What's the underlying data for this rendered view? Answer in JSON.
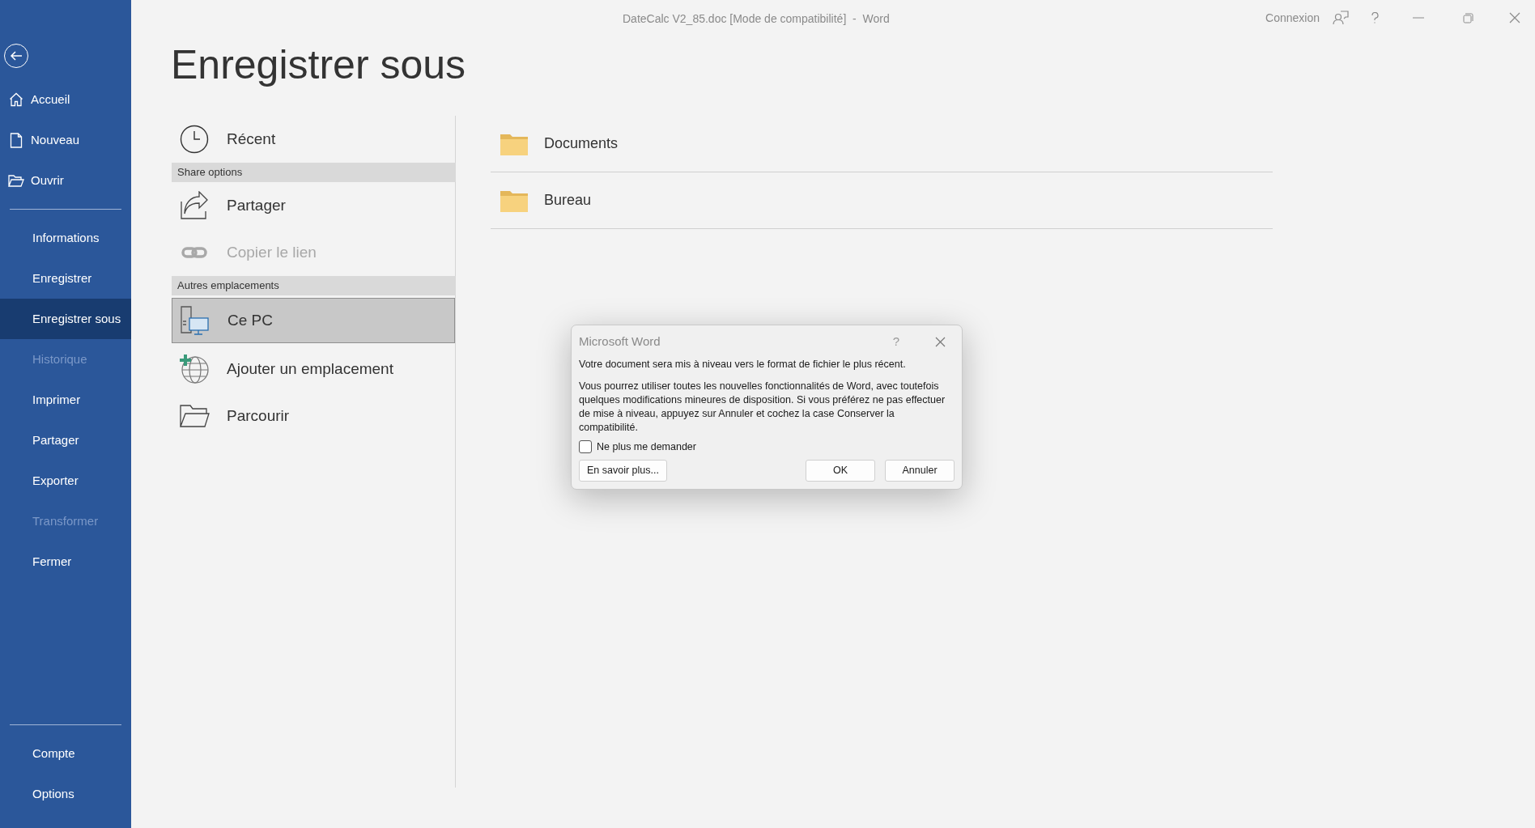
{
  "window": {
    "title": "DateCalc V2_85.doc [Mode de compatibilité]  -  Word",
    "sign_in": "Connexion"
  },
  "sidebar": {
    "top_items": [
      {
        "label": "Accueil"
      },
      {
        "label": "Nouveau"
      },
      {
        "label": "Ouvrir"
      }
    ],
    "items": [
      {
        "label": "Informations",
        "selected": false,
        "disabled": false
      },
      {
        "label": "Enregistrer",
        "selected": false,
        "disabled": false
      },
      {
        "label": "Enregistrer sous",
        "selected": true,
        "disabled": false
      },
      {
        "label": "Historique",
        "selected": false,
        "disabled": true
      },
      {
        "label": "Imprimer",
        "selected": false,
        "disabled": false
      },
      {
        "label": "Partager",
        "selected": false,
        "disabled": false
      },
      {
        "label": "Exporter",
        "selected": false,
        "disabled": false
      },
      {
        "label": "Transformer",
        "selected": false,
        "disabled": true
      },
      {
        "label": "Fermer",
        "selected": false,
        "disabled": false
      }
    ],
    "bottom_items": [
      {
        "label": "Compte"
      },
      {
        "label": "Options"
      }
    ]
  },
  "page_title": "Enregistrer sous",
  "locations": [
    {
      "items": [
        {
          "label": "Récent",
          "selected": false,
          "disabled": false
        }
      ]
    },
    {
      "header": "Share options",
      "items": [
        {
          "label": "Partager",
          "selected": false,
          "disabled": false
        },
        {
          "label": "Copier le lien",
          "selected": false,
          "disabled": true
        }
      ]
    },
    {
      "header": "Autres emplacements",
      "items": [
        {
          "label": "Ce PC",
          "selected": true,
          "disabled": false
        },
        {
          "label": "Ajouter un emplacement",
          "selected": false,
          "disabled": false
        },
        {
          "label": "Parcourir",
          "selected": false,
          "disabled": false
        }
      ]
    }
  ],
  "folders": [
    {
      "name": "Documents"
    },
    {
      "name": "Bureau"
    }
  ],
  "dialog": {
    "title": "Microsoft Word",
    "help": "?",
    "messages": [
      "Votre document sera mis à niveau vers le format de fichier le plus récent.",
      "Vous pourrez utiliser toutes les nouvelles fonctionnalités de Word, avec toutefois quelques modifications mineures de disposition. Si vous préférez ne pas effectuer de mise à niveau, appuyez sur Annuler et cochez la case Conserver la compatibilité."
    ],
    "checkbox": {
      "label": "Ne plus me demander",
      "checked": false
    },
    "buttons": [
      "En savoir plus...",
      "OK",
      "Annuler"
    ]
  }
}
